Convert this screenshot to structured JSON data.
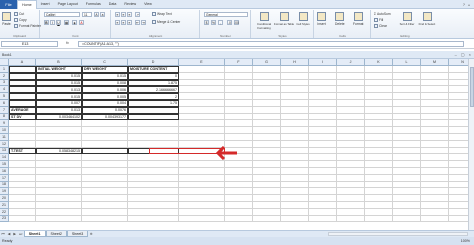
{
  "ribbon": {
    "tabs": [
      "File",
      "Home",
      "Insert",
      "Page Layout",
      "Formulas",
      "Data",
      "Review",
      "View"
    ],
    "clipboard": {
      "cut": "Cut",
      "copy": "Copy",
      "paste": "Paste",
      "format_painter": "Format Painter",
      "label": "Clipboard"
    },
    "font": {
      "name": "Calibri",
      "size": "11",
      "label": "Font"
    },
    "alignment": {
      "wrap": "Wrap Text",
      "merge": "Merge & Center",
      "label": "Alignment"
    },
    "number": {
      "format": "General",
      "label": "Number"
    },
    "styles": {
      "conditional": "Conditional Formatting",
      "format_table": "Format as Table",
      "cell_styles": "Cell Styles",
      "label": "Styles"
    },
    "cells": {
      "insert": "Insert",
      "delete": "Delete",
      "format": "Format",
      "label": "Cells"
    },
    "editing": {
      "autosum": "AutoSum",
      "fill": "Fill",
      "clear": "Clear",
      "sort": "Sort & Filter",
      "find": "Find & Select",
      "label": "Editing"
    }
  },
  "formula_bar": {
    "name_box": "E13",
    "fx": "fx",
    "formula": "=COUNTIF(A1:A13, \"\")"
  },
  "workbook_title": "Book1",
  "columns": [
    "A",
    "B",
    "C",
    "D",
    "E",
    "F",
    "G",
    "H",
    "I",
    "J",
    "K",
    "L",
    "M",
    "N",
    "O",
    "P"
  ],
  "rows": [
    "1",
    "2",
    "3",
    "4",
    "5",
    "6",
    "7",
    "8",
    "9",
    "10",
    "11",
    "12",
    "13",
    "14",
    "15",
    "16",
    "17",
    "18",
    "19",
    "20",
    "21",
    "22",
    "23"
  ],
  "cells": {
    "B1": "INITIAL WEIGHT",
    "C1": "DRY WEIGHT",
    "D1": "MOISTURE CONTENT",
    "B2": "0.015",
    "C2": "0.015",
    "D2": "0",
    "B3": "0.015",
    "C3": "0.008",
    "D3": "1.875",
    "B4": "0.013",
    "C4": "0.006",
    "D4": "2.166666667",
    "B5": "0.015",
    "C5": "0.005",
    "D5": "2",
    "B6": "0.007",
    "C6": "0.004",
    "D6": "1.75",
    "A7": "AVERAGE",
    "B7": "0.013",
    "C7": "0.0076",
    "A8": "ST DV",
    "B8": "0.003464102",
    "C8": "0.004393177",
    "A13": "T.TEST",
    "B13": "0.058348215",
    "E13": "10"
  },
  "sheets": [
    "Sheet1",
    "Sheet2",
    "Sheet3"
  ],
  "status": {
    "ready": "Ready",
    "zoom": "100%"
  },
  "colors": {
    "file_tab": "#2a62ad",
    "selection": "#d42a2a",
    "header_bg": "#e4ecf7"
  }
}
